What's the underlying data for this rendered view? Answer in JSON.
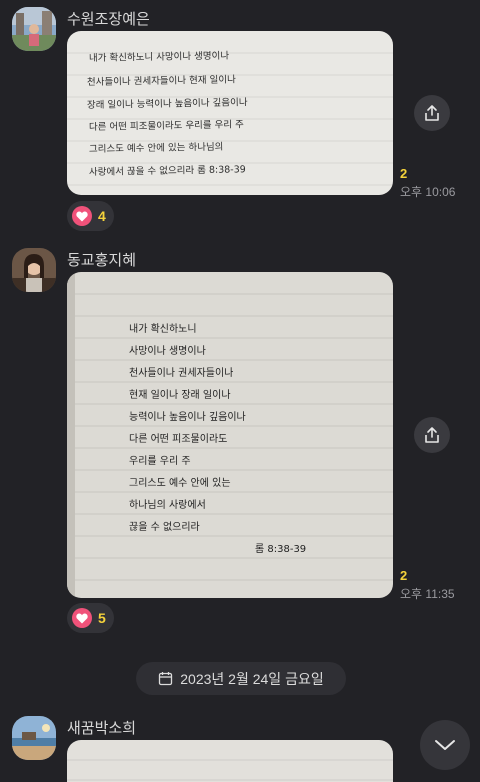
{
  "messages": [
    {
      "sender": "수원조장예은",
      "unread": "2",
      "time": "오후 10:06",
      "reaction_count": "4",
      "note_lines": [
        "내가 확신하노니 사망이나 생명이나",
        "천사들이나 권세자들이나 현재 일이나",
        "장래 일이나 능력이나 높음이나 깊음이나",
        "다른 어떤 피조물이라도 우리를 우리 주",
        "그리스도 예수 안에 있는 하나님의",
        "사랑에서 끊을 수 없으리라   롬 8:38-39"
      ]
    },
    {
      "sender": "동교홍지혜",
      "unread": "2",
      "time": "오후 11:35",
      "reaction_count": "5",
      "note_lines": [
        "내가 확신하노니",
        "사망이나 생명이나",
        "천사들이나 권세자들이나",
        "현재 일이나 장래 일이나",
        "능력이나 높음이나 깊음이나",
        "다른 어떤 피조물이라도",
        "우리를 우리 주",
        "그리스도 예수 안에 있는",
        "하나님의 사랑에서",
        "끊을 수 없으리라",
        "롬 8:38-39"
      ]
    },
    {
      "sender": "새꿈박소희"
    }
  ],
  "date_divider": "2023년 2월 24일 금요일",
  "colors": {
    "background": "#222226",
    "unread_yellow": "#f5d33b",
    "heart_pink": "#f0527a"
  },
  "icons": [
    "share-icon",
    "heart-icon",
    "calendar-icon",
    "chevron-down-icon"
  ]
}
